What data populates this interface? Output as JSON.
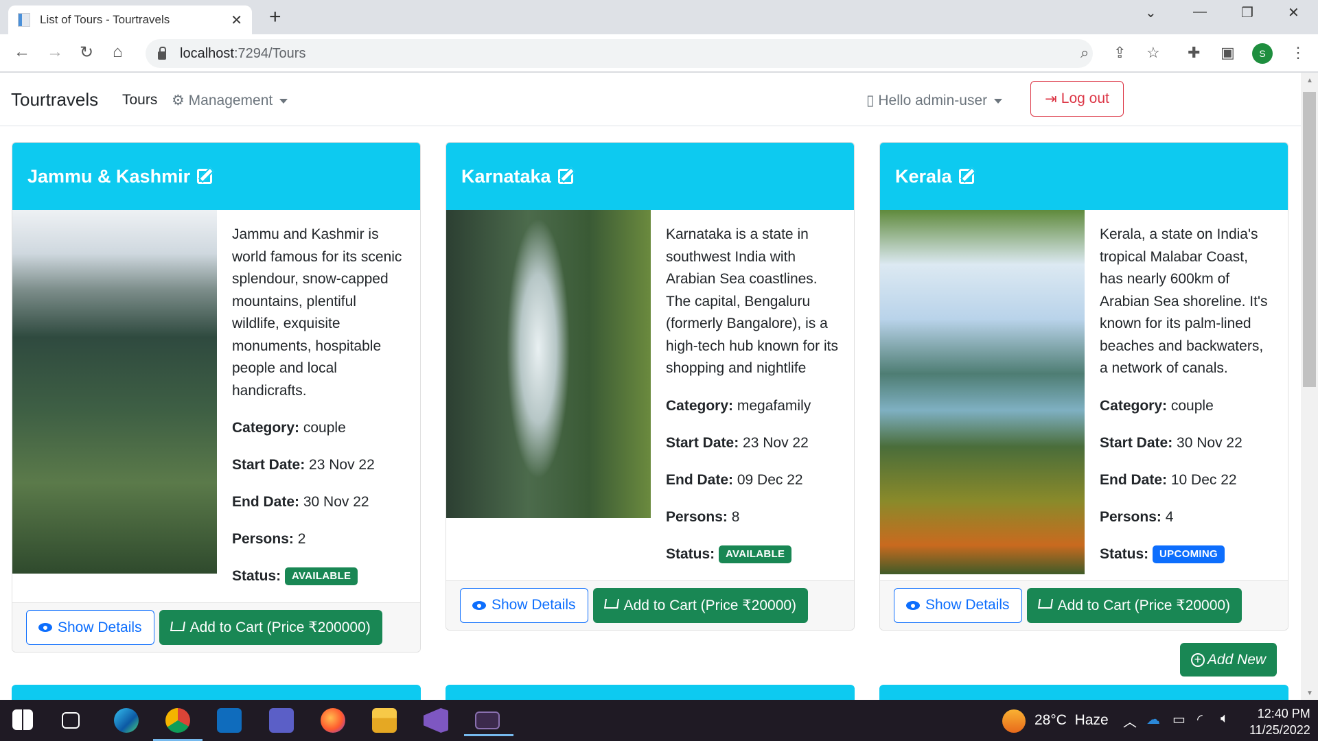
{
  "browser": {
    "tab_title": "List of Tours - Tourtravels",
    "url_host": "localhost",
    "url_path": ":7294/Tours"
  },
  "navbar": {
    "brand": "Tourtravels",
    "tours": "Tours",
    "management": "Management",
    "user": "Hello admin-user",
    "logout": "Log out"
  },
  "labels": {
    "category": "Category:",
    "start": "Start Date:",
    "end": "End Date:",
    "persons": "Persons:",
    "status": "Status:",
    "show_details": "Show Details",
    "add_new": "Add New"
  },
  "tours": [
    {
      "title": "Jammu & Kashmir",
      "description": "Jammu and Kashmir is world famous for its scenic splendour, snow-capped mountains, plentiful wildlife, exquisite monuments, hospitable people and local handicrafts.",
      "category": "couple",
      "start": "23 Nov 22",
      "end": "30 Nov 22",
      "persons": "2",
      "status": "AVAILABLE",
      "status_color": "#198754",
      "cart": "Add to Cart (Price ₹200000)"
    },
    {
      "title": "Karnataka",
      "description": "Karnataka is a state in southwest India with Arabian Sea coastlines. The capital, Bengaluru (formerly Bangalore), is a high-tech hub known for its shopping and nightlife",
      "category": "megafamily",
      "start": "23 Nov 22",
      "end": "09 Dec 22",
      "persons": "8",
      "status": "AVAILABLE",
      "status_color": "#198754",
      "cart": "Add to Cart (Price ₹20000)"
    },
    {
      "title": "Kerala",
      "description": "Kerala, a state on India's tropical Malabar Coast, has nearly 600km of Arabian Sea shoreline. It's known for its palm-lined beaches and backwaters, a network of canals.",
      "category": "couple",
      "start": "30 Nov 22",
      "end": "10 Dec 22",
      "persons": "4",
      "status": "UPCOMING",
      "status_color": "#0d6efd",
      "cart": "Add to Cart (Price ₹20000)"
    }
  ],
  "taskbar": {
    "temperature": "28°C",
    "weather": "Haze",
    "time": "12:40 PM",
    "date": "11/25/2022"
  },
  "colors": {
    "header": "#0dcaf0",
    "success": "#198754",
    "primary": "#0d6efd",
    "danger": "#dc3545"
  }
}
